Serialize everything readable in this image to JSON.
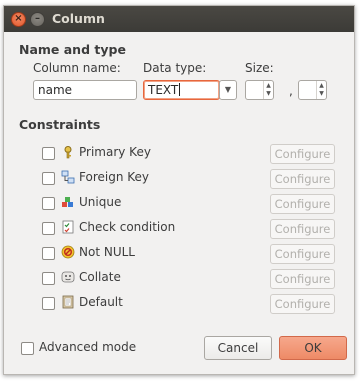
{
  "window": {
    "title": "Column"
  },
  "name_and_type": {
    "heading": "Name and type",
    "column_name_label": "Column name:",
    "column_name_value": "name",
    "data_type_label": "Data type:",
    "data_type_value": "TEXT",
    "size_label": "Size:",
    "size_separator": ","
  },
  "constraints": {
    "heading": "Constraints",
    "items": [
      {
        "label": "Primary Key",
        "icon": "key-icon",
        "configure": "Configure",
        "checked": false
      },
      {
        "label": "Foreign Key",
        "icon": "foreign-key-icon",
        "configure": "Configure",
        "checked": false
      },
      {
        "label": "Unique",
        "icon": "unique-icon",
        "configure": "Configure",
        "checked": false
      },
      {
        "label": "Check condition",
        "icon": "check-condition-icon",
        "configure": "Configure",
        "checked": false
      },
      {
        "label": "Not NULL",
        "icon": "not-null-icon",
        "configure": "Configure",
        "checked": false
      },
      {
        "label": "Collate",
        "icon": "collate-icon",
        "configure": "Configure",
        "checked": false
      },
      {
        "label": "Default",
        "icon": "default-icon",
        "configure": "Configure",
        "checked": false
      }
    ]
  },
  "footer": {
    "advanced_mode_label": "Advanced mode",
    "cancel_label": "Cancel",
    "ok_label": "OK"
  },
  "colors": {
    "accent": "#e7663d",
    "titlebar": "#3c3b37",
    "ok_button": "#ee8a66"
  }
}
